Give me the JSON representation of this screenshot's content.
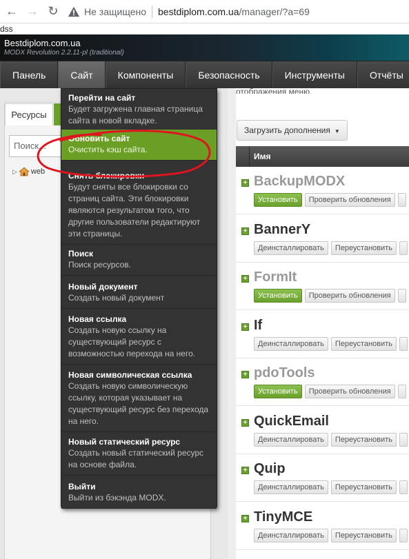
{
  "browser": {
    "security_label": "Не защищено",
    "url_host": "bestdiplom.com.ua",
    "url_path": "/manager/?a=69",
    "bookmark": "dss"
  },
  "header": {
    "site_name": "Bestdiplom.com.ua",
    "version": "MODX Revolution 2.2.11-pl (traditional)"
  },
  "top_nav": [
    {
      "label": "Панель"
    },
    {
      "label": "Сайт"
    },
    {
      "label": "Компоненты"
    },
    {
      "label": "Безопасность"
    },
    {
      "label": "Инструменты"
    },
    {
      "label": "Отчёты"
    }
  ],
  "left": {
    "tab_label": "Ресурсы",
    "search_placeholder": "Поиск...",
    "tree_root": "web"
  },
  "main": {
    "menu_hint": "отображения меню.",
    "download_button": "Загрузить дополнения",
    "grid_col_name": "Имя",
    "packages": [
      {
        "name": "BackupMODX",
        "status": "available",
        "actions": [
          "Установить",
          "Проверить обновления"
        ]
      },
      {
        "name": "BannerY",
        "status": "installed",
        "actions": [
          "Деинсталлировать",
          "Переустановить"
        ]
      },
      {
        "name": "FormIt",
        "status": "available",
        "actions": [
          "Установить",
          "Проверить обновления"
        ]
      },
      {
        "name": "If",
        "status": "installed",
        "actions": [
          "Деинсталлировать",
          "Переустановить"
        ]
      },
      {
        "name": "pdoTools",
        "status": "available",
        "actions": [
          "Установить",
          "Проверить обновления"
        ]
      },
      {
        "name": "QuickEmail",
        "status": "installed",
        "actions": [
          "Деинсталлировать",
          "Переустановить"
        ]
      },
      {
        "name": "Quip",
        "status": "installed",
        "actions": [
          "Деинсталлировать",
          "Переустановить"
        ]
      },
      {
        "name": "TinyMCE",
        "status": "installed",
        "actions": [
          "Деинсталлировать",
          "Переустановить"
        ]
      }
    ]
  },
  "dropdown": [
    {
      "title": "Перейти на сайт",
      "desc": "Будет загружена главная страница сайта в новой вкладке."
    },
    {
      "title": "Обновить сайт",
      "desc": "Очистить кэш сайта.",
      "highlight": true
    },
    {
      "title": "Снять блокировки",
      "desc": "Будут сняты все блокировки со страниц сайта. Эти блокировки являются результатом того, что другие пользователи редактируют эти страницы."
    },
    {
      "title": "Поиск",
      "desc": "Поиск ресурсов."
    },
    {
      "title": "Новый документ",
      "desc": "Создать новый документ"
    },
    {
      "title": "Новая ссылка",
      "desc": "Создать новую ссылку на существующий ресурс с возможностью перехода на него."
    },
    {
      "title": "Новая символическая ссылка",
      "desc": "Создать новую символическую ссылку, которая указывает на существующий ресурс без перехода на него."
    },
    {
      "title": "Новый статический ресурс",
      "desc": "Создать новый статический ресурс на основе файла."
    },
    {
      "title": "Выйти",
      "desc": "Выйти из бэкэнда MODX."
    }
  ],
  "colors": {
    "accent_green": "#6a9e25",
    "menu_bg": "#333333",
    "annotation_red": "#e0141e"
  }
}
